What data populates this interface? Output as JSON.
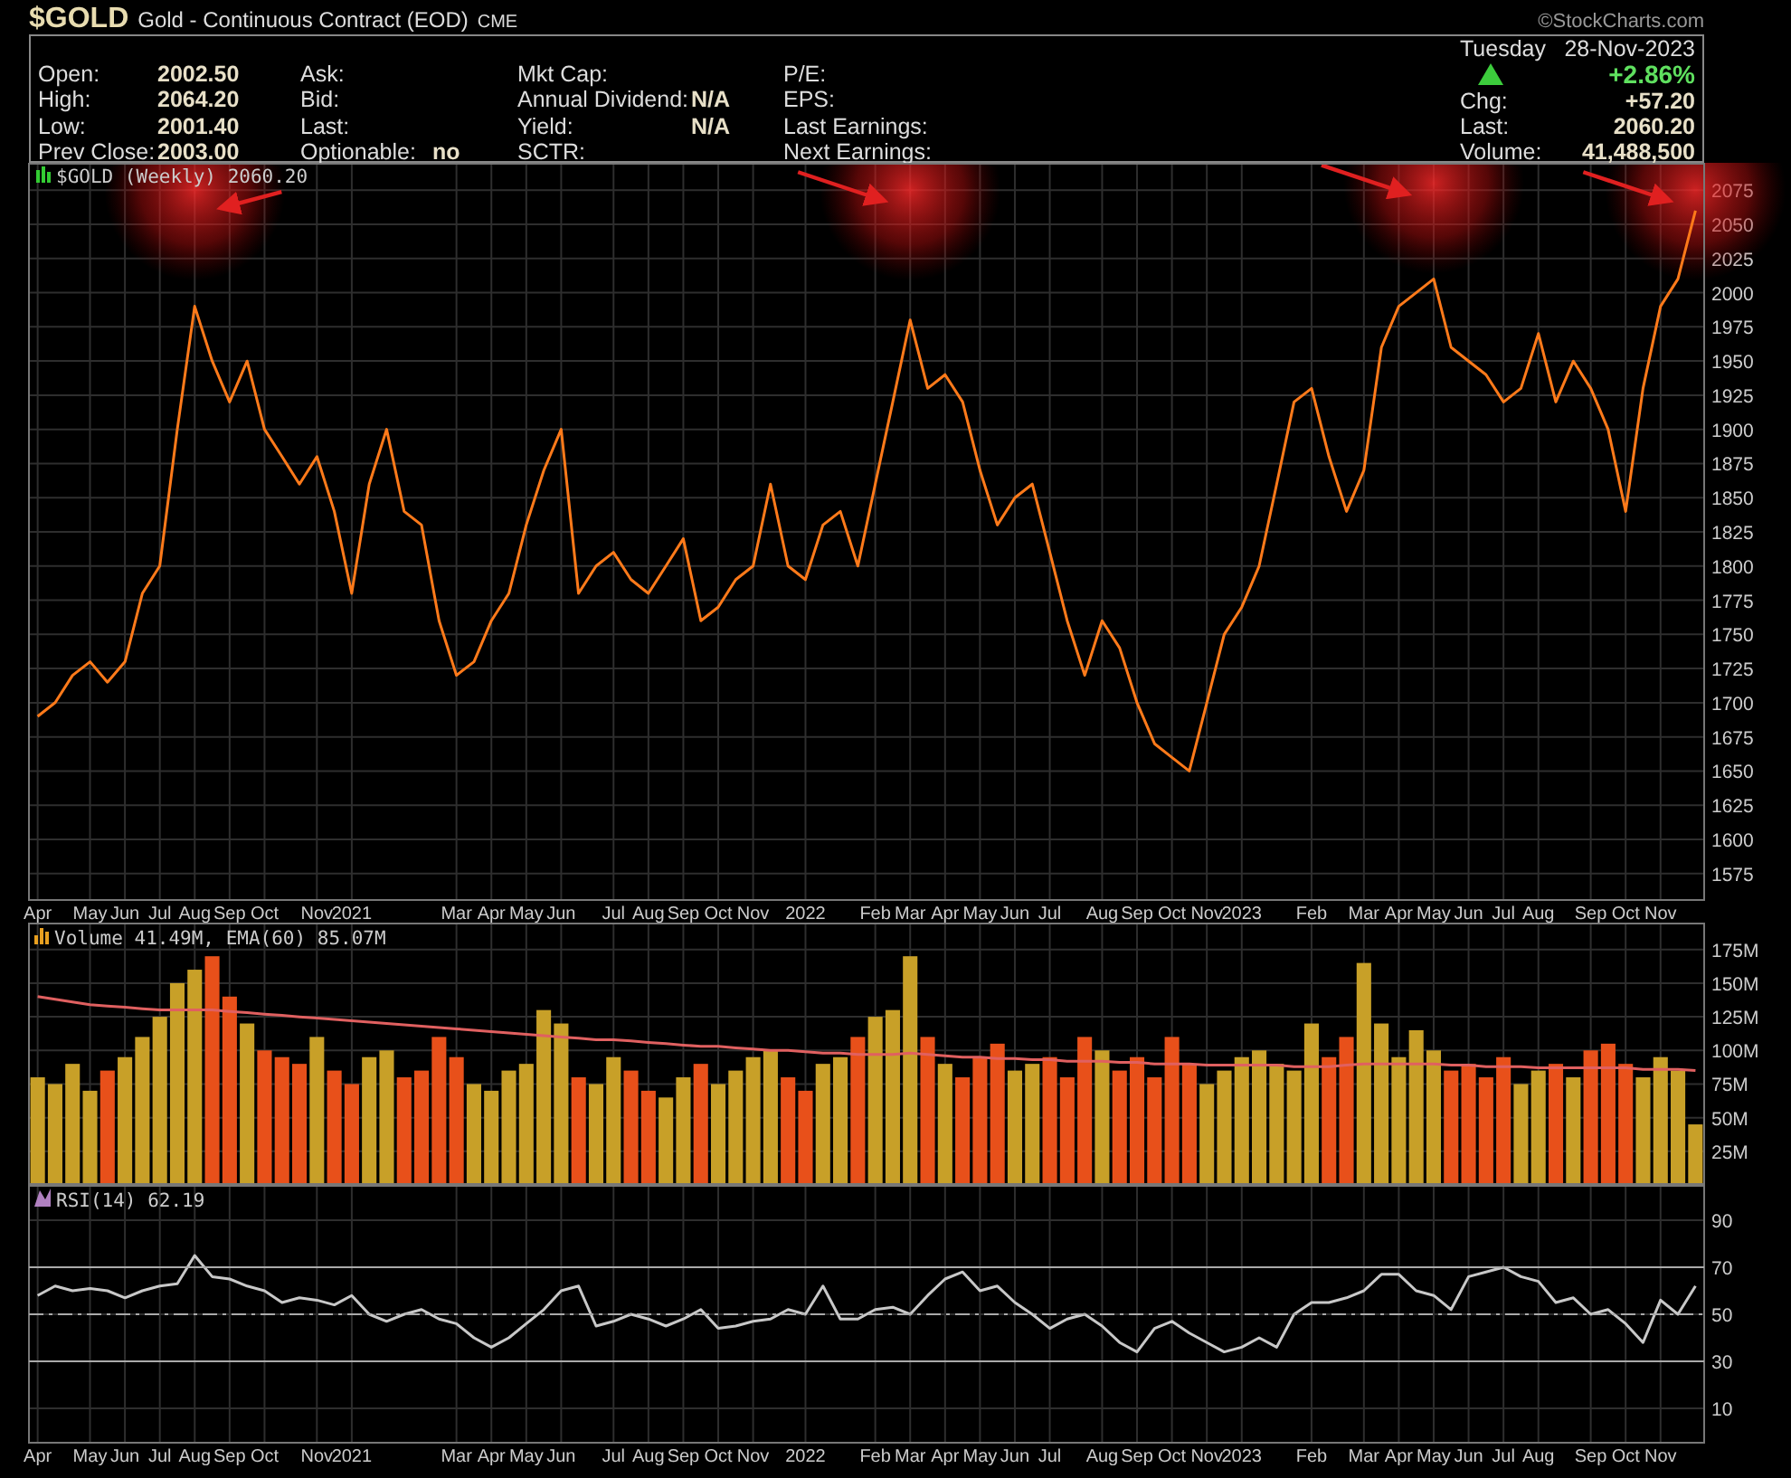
{
  "symbol": "$GOLD",
  "description": "Gold - Continuous Contract (EOD)",
  "exchange": "CME",
  "copyright": "©StockCharts.com",
  "quote_columns": [
    {
      "rows": [
        {
          "label": "Open:",
          "value": "2002.50"
        },
        {
          "label": "High:",
          "value": "2064.20"
        },
        {
          "label": "Low:",
          "value": "2001.40"
        },
        {
          "label": "Prev Close:",
          "value": "2003.00"
        }
      ]
    },
    {
      "rows": [
        {
          "label": "Ask:"
        },
        {
          "label": "Bid:"
        },
        {
          "label": "Last:"
        },
        {
          "label": "Optionable:",
          "value": "no"
        }
      ]
    },
    {
      "rows": [
        {
          "label": "Mkt Cap:"
        },
        {
          "label": "Annual Dividend:",
          "value": "N/A"
        },
        {
          "label": "Yield:",
          "value": "N/A"
        },
        {
          "label": "SCTR:"
        }
      ]
    },
    {
      "rows": [
        {
          "label": "P/E:"
        },
        {
          "label": "EPS:"
        },
        {
          "label": "Last Earnings:"
        },
        {
          "label": "Next Earnings:"
        }
      ]
    }
  ],
  "quote_summary": {
    "day": "Tuesday",
    "date": "28-Nov-2023",
    "rising": true,
    "change_percent": "+2.86%",
    "rows": [
      {
        "label": "Chg:",
        "value": "+57.20"
      },
      {
        "label": "Last:",
        "value": "2060.20"
      },
      {
        "label": "Volume:",
        "value": "41,488,500"
      }
    ]
  },
  "price_panel": {
    "legend": "$GOLD (Weekly) 2060.20",
    "chart_data": {
      "type": "line",
      "grid": true,
      "categories": [
        "Apr",
        null,
        null,
        "May",
        null,
        "Jun",
        null,
        "Jul",
        null,
        "Aug",
        null,
        "Sep",
        null,
        "Oct",
        null,
        null,
        "Nov",
        null,
        "2021",
        null,
        null,
        null,
        null,
        null,
        "Mar",
        null,
        "Apr",
        null,
        "May",
        null,
        "Jun",
        null,
        null,
        "Jul",
        null,
        "Aug",
        null,
        "Sep",
        null,
        "Oct",
        null,
        "Nov",
        null,
        null,
        "2022",
        null,
        null,
        null,
        "Feb",
        null,
        "Mar",
        null,
        "Apr",
        null,
        "May",
        null,
        "Jun",
        null,
        "Jul",
        null,
        null,
        "Aug",
        null,
        "Sep",
        null,
        "Oct",
        null,
        "Nov",
        null,
        "2023",
        null,
        null,
        null,
        "Feb",
        null,
        null,
        "Mar",
        null,
        "Apr",
        null,
        "May",
        null,
        "Jun",
        null,
        "Jul",
        null,
        "Aug",
        null,
        null,
        "Sep",
        null,
        "Oct",
        null,
        "Nov",
        null,
        null
      ],
      "ylim": [
        1555,
        2095
      ],
      "yticks": [
        1575,
        1600,
        1625,
        1650,
        1675,
        1700,
        1725,
        1750,
        1775,
        1800,
        1825,
        1850,
        1875,
        1900,
        1925,
        1950,
        1975,
        2000,
        2025,
        2050,
        2075
      ],
      "series": [
        {
          "color": "#ff7a1a",
          "values": [
            1690,
            1700,
            1720,
            1730,
            1715,
            1730,
            1780,
            1800,
            1900,
            1990,
            1950,
            1920,
            1950,
            1900,
            1880,
            1860,
            1880,
            1840,
            1780,
            1860,
            1900,
            1840,
            1830,
            1760,
            1720,
            1730,
            1760,
            1780,
            1830,
            1870,
            1900,
            1780,
            1800,
            1810,
            1790,
            1780,
            1800,
            1820,
            1760,
            1770,
            1790,
            1800,
            1860,
            1800,
            1790,
            1830,
            1840,
            1800,
            1860,
            1920,
            1980,
            1930,
            1940,
            1920,
            1870,
            1830,
            1850,
            1860,
            1810,
            1760,
            1720,
            1760,
            1740,
            1700,
            1670,
            1660,
            1650,
            1700,
            1750,
            1770,
            1800,
            1860,
            1920,
            1930,
            1880,
            1840,
            1870,
            1960,
            1990,
            2000,
            2010,
            1960,
            1950,
            1940,
            1920,
            1930,
            1970,
            1920,
            1950,
            1930,
            1900,
            1840,
            1930,
            1990,
            2010,
            2060
          ]
        }
      ]
    }
  },
  "volume_panel": {
    "legend": "Volume 41.49M, EMA(60) 85.07M",
    "chart_data": {
      "type": "bar",
      "grid": true,
      "ylim": [
        0,
        195
      ],
      "yticks": [
        {
          "value": 25,
          "label": "25M"
        },
        {
          "value": 50,
          "label": "50M"
        },
        {
          "value": 75,
          "label": "75M"
        },
        {
          "value": 100,
          "label": "100M"
        },
        {
          "value": 125,
          "label": "125M"
        },
        {
          "value": 150,
          "label": "150M"
        },
        {
          "value": 175,
          "label": "175M"
        }
      ],
      "series": [
        {
          "color": "#c8a028",
          "values": [
            80,
            75,
            90,
            70,
            null,
            95,
            110,
            125,
            150,
            160,
            null,
            null,
            120,
            null,
            null,
            null,
            110,
            null,
            null,
            95,
            100,
            null,
            null,
            null,
            null,
            75,
            70,
            85,
            90,
            130,
            120,
            null,
            75,
            95,
            null,
            null,
            65,
            80,
            null,
            75,
            85,
            95,
            100,
            null,
            null,
            90,
            95,
            null,
            125,
            130,
            170,
            null,
            90,
            null,
            null,
            null,
            85,
            90,
            null,
            null,
            null,
            100,
            null,
            null,
            null,
            null,
            null,
            75,
            85,
            95,
            100,
            90,
            85,
            120,
            null,
            null,
            165,
            120,
            95,
            115,
            100,
            null,
            null,
            null,
            null,
            75,
            85,
            null,
            80,
            null,
            null,
            null,
            80,
            95,
            85,
            45
          ]
        },
        {
          "color": "#e8501a",
          "values": [
            null,
            null,
            null,
            null,
            85,
            null,
            null,
            null,
            null,
            null,
            170,
            140,
            null,
            100,
            95,
            90,
            null,
            85,
            75,
            null,
            null,
            80,
            85,
            110,
            95,
            null,
            null,
            null,
            null,
            null,
            null,
            80,
            null,
            null,
            85,
            70,
            null,
            null,
            90,
            null,
            null,
            null,
            null,
            80,
            70,
            null,
            null,
            110,
            null,
            null,
            null,
            110,
            null,
            80,
            95,
            105,
            null,
            null,
            95,
            80,
            110,
            null,
            85,
            95,
            80,
            110,
            90,
            null,
            null,
            null,
            null,
            null,
            null,
            null,
            95,
            110,
            null,
            null,
            null,
            null,
            null,
            85,
            90,
            80,
            95,
            null,
            null,
            90,
            null,
            100,
            105,
            90,
            null,
            null,
            null,
            null
          ]
        },
        {
          "type": "line",
          "color": "#e06060",
          "values": [
            140,
            138,
            136,
            134,
            133,
            132,
            131,
            130,
            130,
            130,
            130,
            129,
            128,
            127,
            126,
            125,
            124,
            123,
            122,
            121,
            120,
            119,
            118,
            117,
            116,
            115,
            114,
            113,
            112,
            111,
            110,
            109,
            108,
            108,
            107,
            106,
            105,
            104,
            103,
            103,
            102,
            101,
            100,
            100,
            99,
            98,
            98,
            97,
            97,
            97,
            98,
            97,
            96,
            95,
            95,
            94,
            94,
            93,
            93,
            92,
            92,
            92,
            91,
            91,
            90,
            90,
            90,
            89,
            89,
            89,
            89,
            89,
            88,
            88,
            88,
            89,
            90,
            90,
            90,
            90,
            90,
            89,
            89,
            88,
            88,
            88,
            87,
            87,
            87,
            87,
            87,
            87,
            86,
            86,
            86,
            85
          ]
        }
      ]
    }
  },
  "rsi_panel": {
    "legend": "RSI(14) 62.19",
    "chart_data": {
      "type": "line",
      "grid": true,
      "categories": [
        "Apr",
        null,
        null,
        "May",
        null,
        "Jun",
        null,
        "Jul",
        null,
        "Aug",
        null,
        "Sep",
        null,
        "Oct",
        null,
        null,
        "Nov",
        null,
        "2021",
        null,
        null,
        null,
        null,
        null,
        "Mar",
        null,
        "Apr",
        null,
        "May",
        null,
        "Jun",
        null,
        null,
        "Jul",
        null,
        "Aug",
        null,
        "Sep",
        null,
        "Oct",
        null,
        "Nov",
        null,
        null,
        "2022",
        null,
        null,
        null,
        "Feb",
        null,
        "Mar",
        null,
        "Apr",
        null,
        "May",
        null,
        "Jun",
        null,
        "Jul",
        null,
        null,
        "Aug",
        null,
        "Sep",
        null,
        "Oct",
        null,
        "Nov",
        null,
        "2023",
        null,
        null,
        null,
        "Feb",
        null,
        null,
        "Mar",
        null,
        "Apr",
        null,
        "May",
        null,
        "Jun",
        null,
        "Jul",
        null,
        "Aug",
        null,
        null,
        "Sep",
        null,
        "Oct",
        null,
        "Nov",
        null,
        null
      ],
      "ylim": [
        -5,
        105
      ],
      "yticks": [
        10,
        30,
        50,
        70,
        90
      ],
      "series": [
        {
          "color": "#c8c8c8",
          "values": [
            58,
            62,
            60,
            61,
            60,
            57,
            60,
            62,
            63,
            75,
            66,
            65,
            62,
            60,
            55,
            57,
            56,
            54,
            58,
            50,
            47,
            50,
            52,
            48,
            46,
            40,
            36,
            40,
            46,
            52,
            60,
            62,
            45,
            47,
            50,
            48,
            45,
            48,
            52,
            44,
            45,
            47,
            48,
            52,
            50,
            62,
            48,
            48,
            52,
            53,
            50,
            58,
            65,
            68,
            60,
            62,
            55,
            50,
            44,
            48,
            50,
            45,
            38,
            34,
            44,
            47,
            42,
            38,
            34,
            36,
            40,
            36,
            50,
            55,
            55,
            57,
            60,
            67,
            67,
            60,
            58,
            52,
            66,
            68,
            70,
            66,
            64,
            55,
            57,
            50,
            52,
            46,
            38,
            56,
            50,
            62
          ]
        }
      ]
    }
  }
}
